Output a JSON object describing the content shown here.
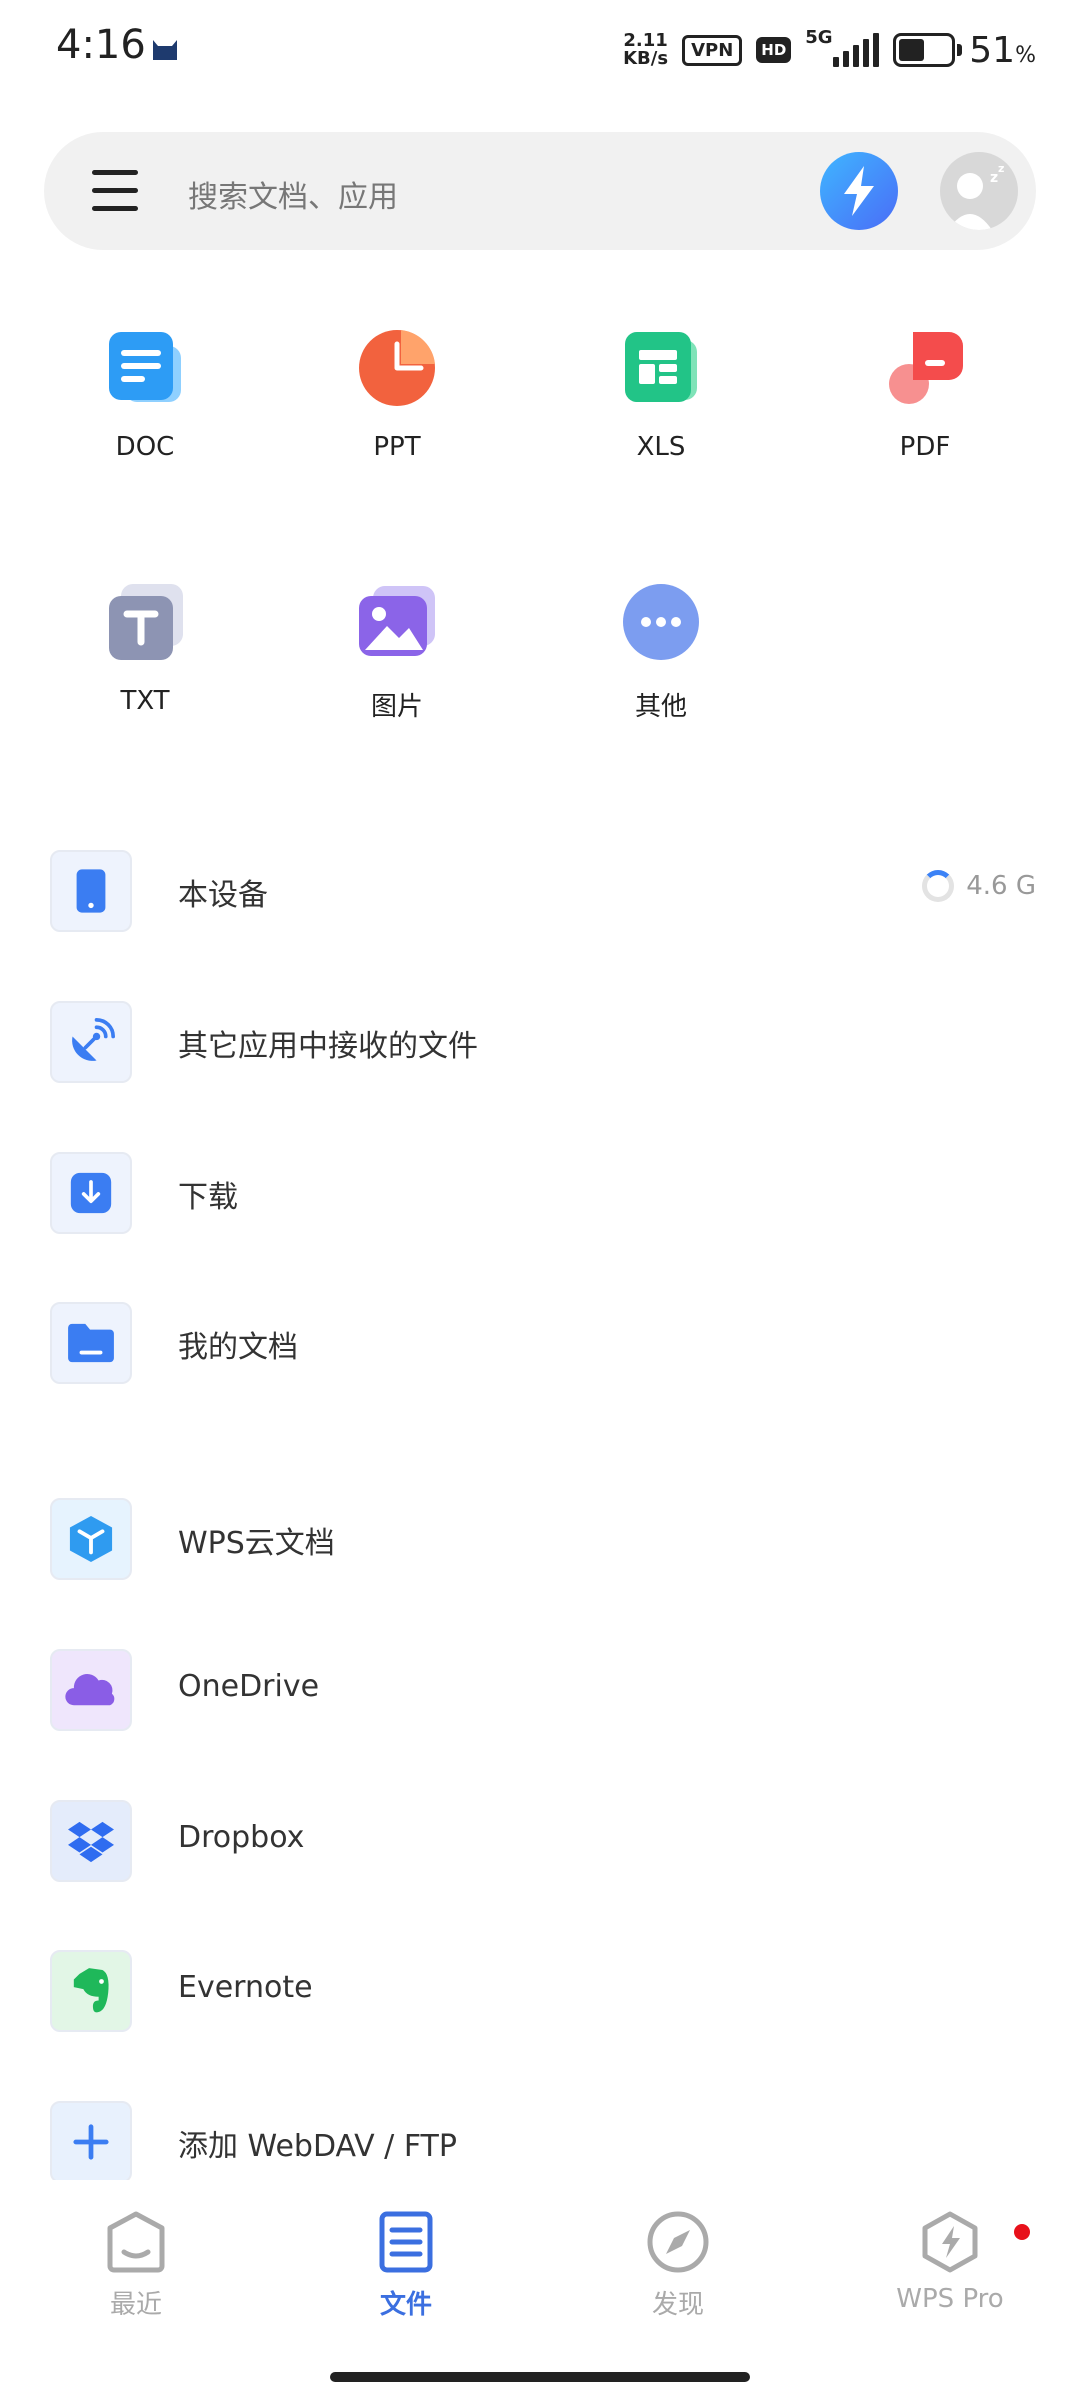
{
  "status_bar": {
    "time": "4:16",
    "net_speed_value": "2.11",
    "net_speed_unit": "KB/s",
    "vpn": "VPN",
    "hd": "HD",
    "network": "5G",
    "battery_percent": "51",
    "battery_unit": "%",
    "battery_level": 0.51
  },
  "search": {
    "placeholder": "搜索文档、应用"
  },
  "categories": [
    {
      "label": "DOC",
      "icon": "doc-icon"
    },
    {
      "label": "PPT",
      "icon": "ppt-icon"
    },
    {
      "label": "XLS",
      "icon": "xls-icon"
    },
    {
      "label": "PDF",
      "icon": "pdf-icon"
    },
    {
      "label": "TXT",
      "icon": "txt-icon"
    },
    {
      "label": "图片",
      "icon": "image-icon"
    },
    {
      "label": "其他",
      "icon": "more-icon"
    }
  ],
  "locations": [
    {
      "label": "本设备",
      "icon": "phone-icon",
      "storage": "4.6 G"
    },
    {
      "label": "其它应用中接收的文件",
      "icon": "satellite-icon"
    },
    {
      "label": "下载",
      "icon": "download-icon"
    },
    {
      "label": "我的文档",
      "icon": "folder-icon"
    }
  ],
  "cloud": [
    {
      "label": "WPS云文档",
      "icon": "wps-cloud-icon"
    },
    {
      "label": "OneDrive",
      "icon": "onedrive-icon"
    },
    {
      "label": "Dropbox",
      "icon": "dropbox-icon"
    },
    {
      "label": "Evernote",
      "icon": "evernote-icon"
    },
    {
      "label": "添加 WebDAV / FTP",
      "icon": "add-icon"
    }
  ],
  "bottom_nav": [
    {
      "label": "最近",
      "icon": "recent-icon",
      "active": false
    },
    {
      "label": "文件",
      "icon": "file-icon",
      "active": true
    },
    {
      "label": "发现",
      "icon": "compass-icon",
      "active": false
    },
    {
      "label": "WPS Pro",
      "icon": "wps-pro-icon",
      "active": false
    }
  ],
  "colors": {
    "accent": "#3b6fe0",
    "notification_dot": "#e8101a"
  }
}
